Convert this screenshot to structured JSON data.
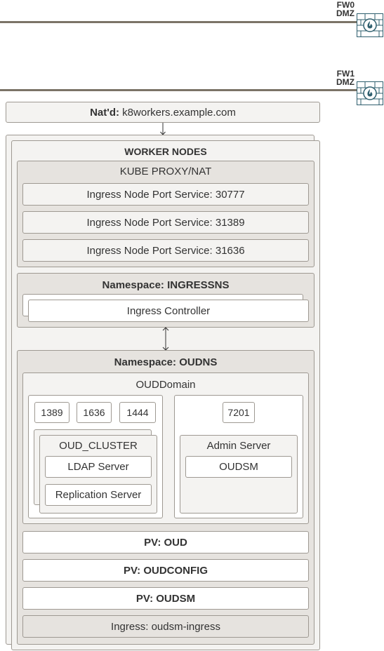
{
  "firewalls": [
    {
      "name": "FW0",
      "zone": "DMZ"
    },
    {
      "name": "FW1",
      "zone": "DMZ"
    }
  ],
  "nat": {
    "prefix": "Nat'd:",
    "host": "k8workers.example.com"
  },
  "worker_nodes": {
    "title": "WORKER NODES"
  },
  "kube_proxy": {
    "title": "KUBE PROXY/NAT",
    "services": [
      "Ingress Node Port Service: 30777",
      "Ingress Node Port Service: 31389",
      "Ingress Node Port Service: 31636"
    ]
  },
  "ingress_ns": {
    "title": "Namespace: INGRESSNS",
    "controller": "Ingress Controller"
  },
  "oud_ns": {
    "title": "Namespace: OUDNS",
    "domain": "OUDDomain",
    "ports": [
      "1389",
      "1636",
      "1444"
    ],
    "admin_port": "7201",
    "cluster": {
      "title": "OUD_CLUSTER",
      "servers": [
        "LDAP Server",
        "Replication Server"
      ]
    },
    "admin": {
      "title": "Admin Server",
      "app": "OUDSM"
    },
    "volumes": [
      "PV: OUD",
      "PV: OUDCONFIG",
      "PV: OUDSM"
    ],
    "ingress": "Ingress: oudsm-ingress"
  },
  "colors": {
    "line": "#7b7467",
    "border": "#9e9992",
    "light": "#f4f3f1",
    "mid": "#e6e3df",
    "firewall": "#2f5f6e"
  }
}
